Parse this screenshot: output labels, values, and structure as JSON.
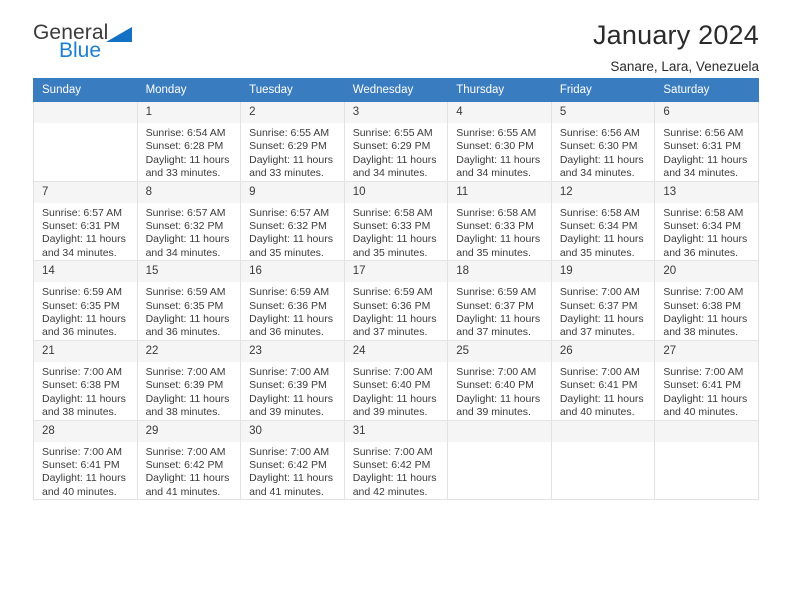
{
  "brand": {
    "line1": "General",
    "line2": "Blue",
    "triangle_icon": "triangle-icon",
    "accent_color": "#1b7fd4"
  },
  "header": {
    "title": "January 2024",
    "location": "Sanare, Lara, Venezuela"
  },
  "calendar": {
    "header_bg": "#3a7cc0",
    "weekdays": [
      "Sunday",
      "Monday",
      "Tuesday",
      "Wednesday",
      "Thursday",
      "Friday",
      "Saturday"
    ],
    "weeks": [
      [
        {
          "day": "",
          "sunrise": "",
          "sunset": "",
          "daylight1": "",
          "daylight2": ""
        },
        {
          "day": "1",
          "sunrise": "Sunrise: 6:54 AM",
          "sunset": "Sunset: 6:28 PM",
          "daylight1": "Daylight: 11 hours",
          "daylight2": "and 33 minutes."
        },
        {
          "day": "2",
          "sunrise": "Sunrise: 6:55 AM",
          "sunset": "Sunset: 6:29 PM",
          "daylight1": "Daylight: 11 hours",
          "daylight2": "and 33 minutes."
        },
        {
          "day": "3",
          "sunrise": "Sunrise: 6:55 AM",
          "sunset": "Sunset: 6:29 PM",
          "daylight1": "Daylight: 11 hours",
          "daylight2": "and 34 minutes."
        },
        {
          "day": "4",
          "sunrise": "Sunrise: 6:55 AM",
          "sunset": "Sunset: 6:30 PM",
          "daylight1": "Daylight: 11 hours",
          "daylight2": "and 34 minutes."
        },
        {
          "day": "5",
          "sunrise": "Sunrise: 6:56 AM",
          "sunset": "Sunset: 6:30 PM",
          "daylight1": "Daylight: 11 hours",
          "daylight2": "and 34 minutes."
        },
        {
          "day": "6",
          "sunrise": "Sunrise: 6:56 AM",
          "sunset": "Sunset: 6:31 PM",
          "daylight1": "Daylight: 11 hours",
          "daylight2": "and 34 minutes."
        }
      ],
      [
        {
          "day": "7",
          "sunrise": "Sunrise: 6:57 AM",
          "sunset": "Sunset: 6:31 PM",
          "daylight1": "Daylight: 11 hours",
          "daylight2": "and 34 minutes."
        },
        {
          "day": "8",
          "sunrise": "Sunrise: 6:57 AM",
          "sunset": "Sunset: 6:32 PM",
          "daylight1": "Daylight: 11 hours",
          "daylight2": "and 34 minutes."
        },
        {
          "day": "9",
          "sunrise": "Sunrise: 6:57 AM",
          "sunset": "Sunset: 6:32 PM",
          "daylight1": "Daylight: 11 hours",
          "daylight2": "and 35 minutes."
        },
        {
          "day": "10",
          "sunrise": "Sunrise: 6:58 AM",
          "sunset": "Sunset: 6:33 PM",
          "daylight1": "Daylight: 11 hours",
          "daylight2": "and 35 minutes."
        },
        {
          "day": "11",
          "sunrise": "Sunrise: 6:58 AM",
          "sunset": "Sunset: 6:33 PM",
          "daylight1": "Daylight: 11 hours",
          "daylight2": "and 35 minutes."
        },
        {
          "day": "12",
          "sunrise": "Sunrise: 6:58 AM",
          "sunset": "Sunset: 6:34 PM",
          "daylight1": "Daylight: 11 hours",
          "daylight2": "and 35 minutes."
        },
        {
          "day": "13",
          "sunrise": "Sunrise: 6:58 AM",
          "sunset": "Sunset: 6:34 PM",
          "daylight1": "Daylight: 11 hours",
          "daylight2": "and 36 minutes."
        }
      ],
      [
        {
          "day": "14",
          "sunrise": "Sunrise: 6:59 AM",
          "sunset": "Sunset: 6:35 PM",
          "daylight1": "Daylight: 11 hours",
          "daylight2": "and 36 minutes."
        },
        {
          "day": "15",
          "sunrise": "Sunrise: 6:59 AM",
          "sunset": "Sunset: 6:35 PM",
          "daylight1": "Daylight: 11 hours",
          "daylight2": "and 36 minutes."
        },
        {
          "day": "16",
          "sunrise": "Sunrise: 6:59 AM",
          "sunset": "Sunset: 6:36 PM",
          "daylight1": "Daylight: 11 hours",
          "daylight2": "and 36 minutes."
        },
        {
          "day": "17",
          "sunrise": "Sunrise: 6:59 AM",
          "sunset": "Sunset: 6:36 PM",
          "daylight1": "Daylight: 11 hours",
          "daylight2": "and 37 minutes."
        },
        {
          "day": "18",
          "sunrise": "Sunrise: 6:59 AM",
          "sunset": "Sunset: 6:37 PM",
          "daylight1": "Daylight: 11 hours",
          "daylight2": "and 37 minutes."
        },
        {
          "day": "19",
          "sunrise": "Sunrise: 7:00 AM",
          "sunset": "Sunset: 6:37 PM",
          "daylight1": "Daylight: 11 hours",
          "daylight2": "and 37 minutes."
        },
        {
          "day": "20",
          "sunrise": "Sunrise: 7:00 AM",
          "sunset": "Sunset: 6:38 PM",
          "daylight1": "Daylight: 11 hours",
          "daylight2": "and 38 minutes."
        }
      ],
      [
        {
          "day": "21",
          "sunrise": "Sunrise: 7:00 AM",
          "sunset": "Sunset: 6:38 PM",
          "daylight1": "Daylight: 11 hours",
          "daylight2": "and 38 minutes."
        },
        {
          "day": "22",
          "sunrise": "Sunrise: 7:00 AM",
          "sunset": "Sunset: 6:39 PM",
          "daylight1": "Daylight: 11 hours",
          "daylight2": "and 38 minutes."
        },
        {
          "day": "23",
          "sunrise": "Sunrise: 7:00 AM",
          "sunset": "Sunset: 6:39 PM",
          "daylight1": "Daylight: 11 hours",
          "daylight2": "and 39 minutes."
        },
        {
          "day": "24",
          "sunrise": "Sunrise: 7:00 AM",
          "sunset": "Sunset: 6:40 PM",
          "daylight1": "Daylight: 11 hours",
          "daylight2": "and 39 minutes."
        },
        {
          "day": "25",
          "sunrise": "Sunrise: 7:00 AM",
          "sunset": "Sunset: 6:40 PM",
          "daylight1": "Daylight: 11 hours",
          "daylight2": "and 39 minutes."
        },
        {
          "day": "26",
          "sunrise": "Sunrise: 7:00 AM",
          "sunset": "Sunset: 6:41 PM",
          "daylight1": "Daylight: 11 hours",
          "daylight2": "and 40 minutes."
        },
        {
          "day": "27",
          "sunrise": "Sunrise: 7:00 AM",
          "sunset": "Sunset: 6:41 PM",
          "daylight1": "Daylight: 11 hours",
          "daylight2": "and 40 minutes."
        }
      ],
      [
        {
          "day": "28",
          "sunrise": "Sunrise: 7:00 AM",
          "sunset": "Sunset: 6:41 PM",
          "daylight1": "Daylight: 11 hours",
          "daylight2": "and 40 minutes."
        },
        {
          "day": "29",
          "sunrise": "Sunrise: 7:00 AM",
          "sunset": "Sunset: 6:42 PM",
          "daylight1": "Daylight: 11 hours",
          "daylight2": "and 41 minutes."
        },
        {
          "day": "30",
          "sunrise": "Sunrise: 7:00 AM",
          "sunset": "Sunset: 6:42 PM",
          "daylight1": "Daylight: 11 hours",
          "daylight2": "and 41 minutes."
        },
        {
          "day": "31",
          "sunrise": "Sunrise: 7:00 AM",
          "sunset": "Sunset: 6:42 PM",
          "daylight1": "Daylight: 11 hours",
          "daylight2": "and 42 minutes."
        },
        {
          "day": "",
          "sunrise": "",
          "sunset": "",
          "daylight1": "",
          "daylight2": ""
        },
        {
          "day": "",
          "sunrise": "",
          "sunset": "",
          "daylight1": "",
          "daylight2": ""
        },
        {
          "day": "",
          "sunrise": "",
          "sunset": "",
          "daylight1": "",
          "daylight2": ""
        }
      ]
    ]
  }
}
